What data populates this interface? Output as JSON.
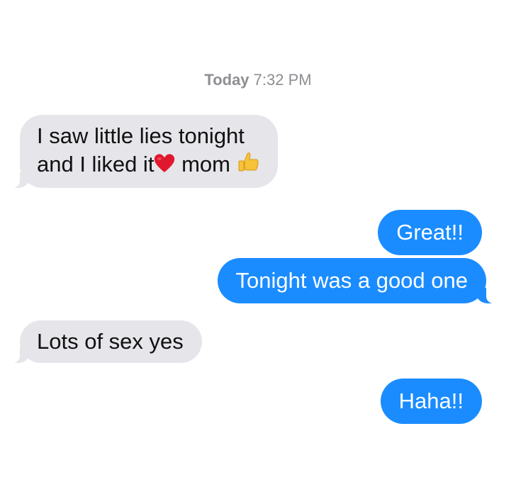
{
  "thread": {
    "timestamp_day": "Today",
    "timestamp_time": "7:32 PM"
  },
  "messages": [
    {
      "direction": "incoming",
      "line1": "I saw little lies tonight",
      "line2_part1": "and I liked it",
      "line2_emoji1": "red-heart",
      "line2_part2": "mom",
      "line2_emoji2": "thumbs-up"
    },
    {
      "direction": "outgoing",
      "text": "Great!!"
    },
    {
      "direction": "outgoing",
      "text": "Tonight was a good one"
    },
    {
      "direction": "incoming",
      "text": "Lots of sex yes"
    },
    {
      "direction": "outgoing",
      "text": "Haha!!"
    }
  ],
  "colors": {
    "incoming_bubble": "#e5e5ea",
    "outgoing_bubble": "#1a8cff",
    "timestamp": "#8e8e93"
  }
}
